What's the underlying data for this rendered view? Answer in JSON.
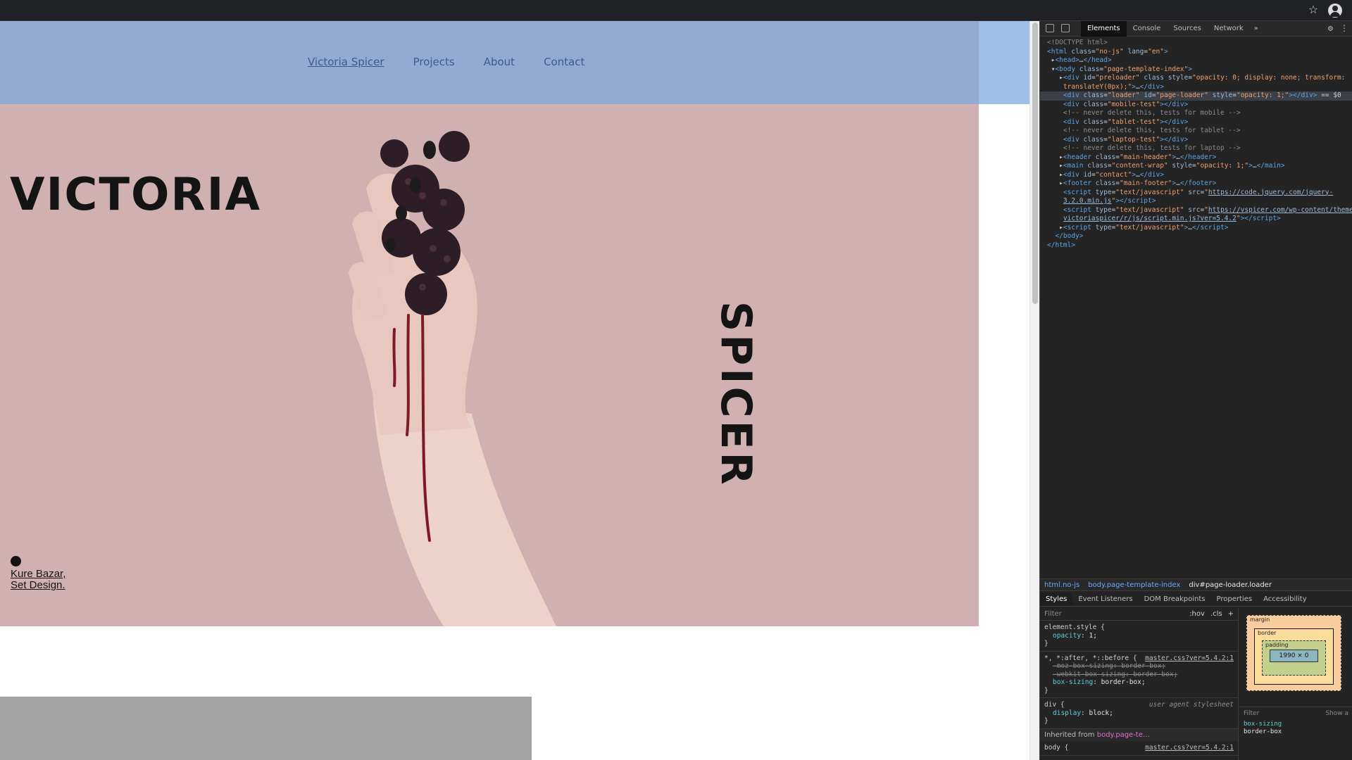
{
  "nav": {
    "items": [
      "Victoria Spicer",
      "Projects",
      "About",
      "Contact"
    ]
  },
  "hero": {
    "first_name": "VICTORIA",
    "last_name": "SPICER",
    "credit_line1": "Kure Bazar,",
    "credit_line2": "Set Design."
  },
  "devtools": {
    "tabs": [
      "Elements",
      "Console",
      "Sources",
      "Network"
    ],
    "more": "»",
    "dom_lines": [
      {
        "html": "<span class='comment'>&lt;!DOCTYPE html&gt;</span>"
      },
      {
        "html": "<span class='tag'>&lt;html</span> <span class='attr'>class</span>=<span class='val'>\"no-js\"</span> <span class='attr'>lang</span>=<span class='val'>\"en\"</span><span class='tag'>&gt;</span>"
      },
      {
        "html": " ▸<span class='tag'>&lt;head&gt;</span>…<span class='tag'>&lt;/head&gt;</span>"
      },
      {
        "html": " ▾<span class='tag'>&lt;body</span> <span class='attr'>class</span>=<span class='val'>\"page-template-index\"</span><span class='tag'>&gt;</span>"
      },
      {
        "html": "   ▸<span class='tag'>&lt;div</span> <span class='attr'>id</span>=<span class='val'>\"preloader\"</span> <span class='attr'>class</span> <span class='attr'>style</span>=<span class='val'>\"opacity: 0; display: none; transform:</span>"
      },
      {
        "html": "    <span class='val'>translateY(0px);\"</span><span class='tag'>&gt;</span>…<span class='tag'>&lt;/div&gt;</span>"
      },
      {
        "html": "    <span class='tag'>&lt;div</span> <span class='attr'>class</span>=<span class='val'>\"loader\"</span> <span class='attr'>id</span>=<span class='val'>\"page-loader\"</span> <span class='attr'>style</span>=<span class='val'>\"opacity: 1;\"</span><span class='tag'>&gt;&lt;/div&gt;</span> == $0",
        "selected": true
      },
      {
        "html": "    <span class='tag'>&lt;div</span> <span class='attr'>class</span>=<span class='val'>\"mobile-test\"</span><span class='tag'>&gt;&lt;/div&gt;</span>"
      },
      {
        "html": "    <span class='comment'>&lt;!-- never delete this, tests for mobile --&gt;</span>"
      },
      {
        "html": "    <span class='tag'>&lt;div</span> <span class='attr'>class</span>=<span class='val'>\"tablet-test\"</span><span class='tag'>&gt;&lt;/div&gt;</span>"
      },
      {
        "html": "    <span class='comment'>&lt;!-- never delete this, tests for tablet --&gt;</span>"
      },
      {
        "html": "    <span class='tag'>&lt;div</span> <span class='attr'>class</span>=<span class='val'>\"laptop-test\"</span><span class='tag'>&gt;&lt;/div&gt;</span>"
      },
      {
        "html": "    <span class='comment'>&lt;!-- never delete this, tests for laptop --&gt;</span>"
      },
      {
        "html": "   ▸<span class='tag'>&lt;header</span> <span class='attr'>class</span>=<span class='val'>\"main-header\"</span><span class='tag'>&gt;</span>…<span class='tag'>&lt;/header&gt;</span>"
      },
      {
        "html": "   ▸<span class='tag'>&lt;main</span> <span class='attr'>class</span>=<span class='val'>\"content-wrap\"</span> <span class='attr'>style</span>=<span class='val'>\"opacity: 1;\"</span><span class='tag'>&gt;</span>…<span class='tag'>&lt;/main&gt;</span>"
      },
      {
        "html": "   ▸<span class='tag'>&lt;div</span> <span class='attr'>id</span>=<span class='val'>\"contact\"</span><span class='tag'>&gt;</span>…<span class='tag'>&lt;/div&gt;</span>"
      },
      {
        "html": "   ▸<span class='tag'>&lt;footer</span> <span class='attr'>class</span>=<span class='val'>\"main-footer\"</span><span class='tag'>&gt;</span>…<span class='tag'>&lt;/footer&gt;</span>"
      },
      {
        "html": "    <span class='tag'>&lt;script</span> <span class='attr'>type</span>=<span class='val'>\"text/javascript\"</span> <span class='attr'>src</span>=<span class='val'>\"</span><span class='link'>https://code.jquery.com/jquery-</span>"
      },
      {
        "html": "    <span class='link'>3.2.0.min.js</span><span class='val'>\"</span><span class='tag'>&gt;&lt;/script&gt;</span>"
      },
      {
        "html": "    <span class='tag'>&lt;script</span> <span class='attr'>type</span>=<span class='val'>\"text/javascript\"</span> <span class='attr'>src</span>=<span class='val'>\"</span><span class='link'>https://vspicer.com/wp-content/themes/</span>"
      },
      {
        "html": "    <span class='link'>victoriaspicer/r/js/script.min.js?ver=5.4.2</span><span class='val'>\"</span><span class='tag'>&gt;&lt;/script&gt;</span>"
      },
      {
        "html": "   ▸<span class='tag'>&lt;script</span> <span class='attr'>type</span>=<span class='val'>\"text/javascript\"</span><span class='tag'>&gt;</span>…<span class='tag'>&lt;/script&gt;</span>"
      },
      {
        "html": "  <span class='tag'>&lt;/body&gt;</span>"
      },
      {
        "html": "<span class='tag'>&lt;/html&gt;</span>"
      }
    ],
    "breadcrumbs": [
      "html.no-js",
      "body.page-template-index",
      "div#page-loader.loader"
    ],
    "panel_tabs": [
      "Styles",
      "Event Listeners",
      "DOM Breakpoints",
      "Properties",
      "Accessibility"
    ],
    "filter_placeholder": "Filter",
    "hov": ":hov",
    "cls": ".cls",
    "plus": "+",
    "rules": {
      "element_selector": "element.style {",
      "opacity_name": "opacity",
      "opacity_value": "1;",
      "close": "}",
      "universal_selector": "*, *:after, *::before {",
      "universal_src": "master.css?ver=5.4.2:1",
      "moz_box_sizing": "-moz-box-sizing: border-box;",
      "webkit_box_sizing": "-webkit-box-sizing: border-box;",
      "box_sizing_name": "box-sizing",
      "box_sizing_value": "border-box;",
      "div_selector": "div {",
      "ua_label": "user agent stylesheet",
      "display_name": "display",
      "display_value": "block;",
      "inherited_prefix": "Inherited from",
      "inherited_from": "body.page-te…",
      "body_selector": "body {",
      "body_src": "master.css?ver=5.4.2:1"
    },
    "box_model": {
      "margin": "margin",
      "border": "border",
      "padding": "padding",
      "content": "1990 × 0",
      "dash": "-"
    },
    "computed": {
      "filter": "Filter",
      "show_all": "Show a",
      "prop_name": "box-sizing",
      "prop_value": "border-box"
    }
  }
}
